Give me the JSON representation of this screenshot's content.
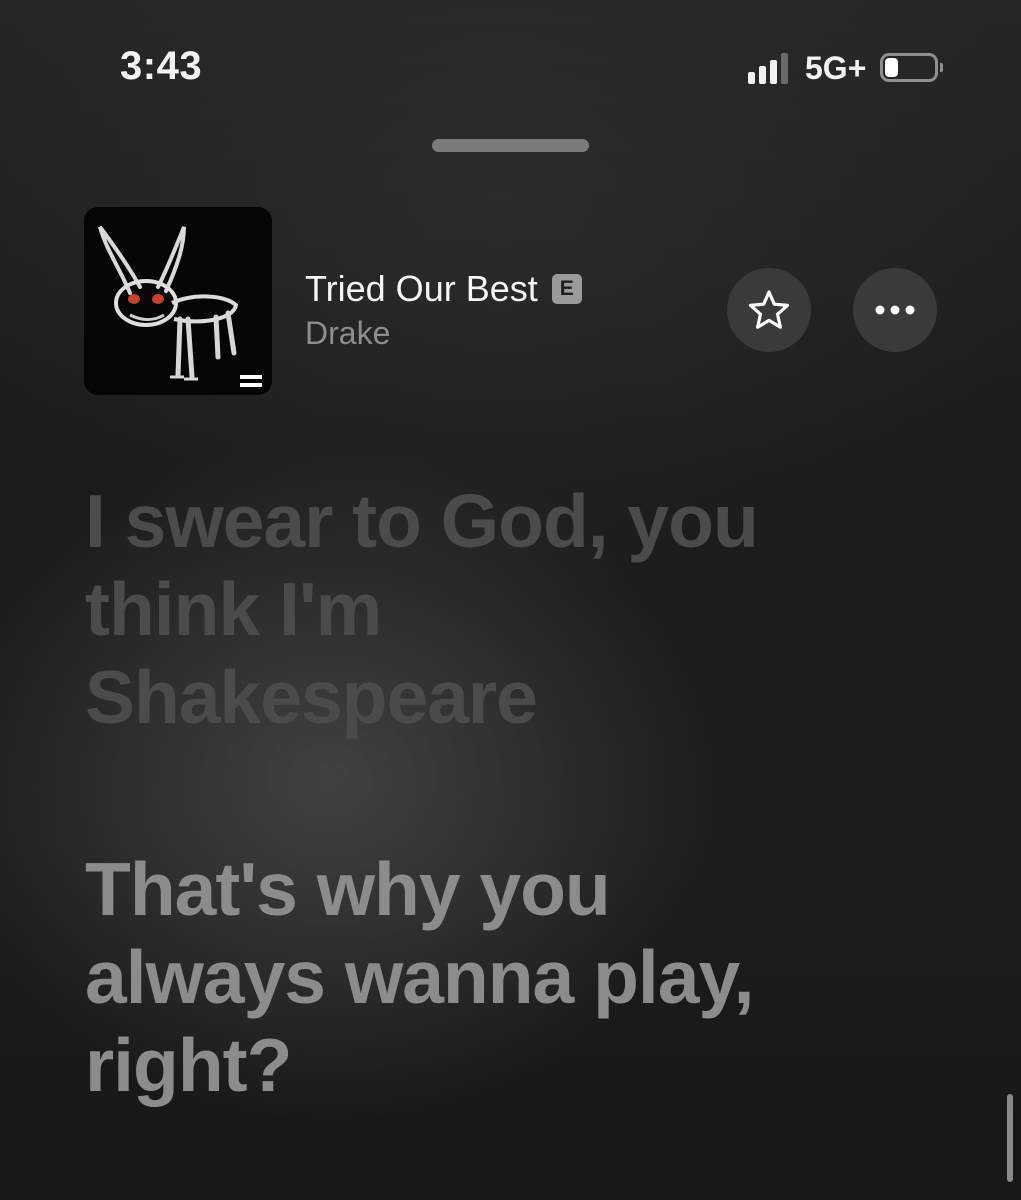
{
  "status_bar": {
    "time": "3:43",
    "network": "5G+",
    "signal_bars_active": 3,
    "signal_bars_total": 4,
    "battery_level": 0.2
  },
  "now_playing": {
    "title": "Tried Our Best",
    "explicit_badge": "E",
    "artist": "Drake",
    "favorite_icon": "star-outline-icon",
    "more_icon": "ellipsis-icon"
  },
  "lyrics": {
    "previous_lines": [
      "I swear to God, you",
      "think I'm",
      "Shakespeare"
    ],
    "current_lines": [
      "That's why you",
      "always wanna play,",
      "right?"
    ]
  },
  "colors": {
    "background": "#1b1b1b",
    "lyric_past": "#4b4b4b",
    "lyric_current": "#8c8c8c",
    "button_bg": "#3a3a3a"
  }
}
